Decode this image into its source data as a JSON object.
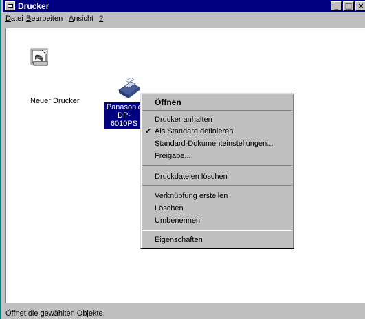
{
  "window": {
    "title": "Drucker",
    "buttons": {
      "minimize": "_",
      "maximize": "□",
      "close": "×"
    }
  },
  "menubar": {
    "items": [
      {
        "label": "Datei",
        "accel": "D"
      },
      {
        "label": "Bearbeiten",
        "accel": "B"
      },
      {
        "label": "Ansicht",
        "accel": "A"
      },
      {
        "label": "?",
        "accel": "?"
      }
    ]
  },
  "icons": [
    {
      "name": "new-printer",
      "label": "Neuer Drucker",
      "icon": "add-printer-icon"
    },
    {
      "name": "panasonic",
      "label_line1": "Panasonic",
      "label_line2": "DP-6010PS",
      "icon": "printer-icon",
      "selected": true
    }
  ],
  "context_menu": {
    "items": [
      {
        "label": "Öffnen",
        "default": true
      },
      {
        "label": "Drucker anhalten"
      },
      {
        "label": "Als Standard definieren",
        "checked": true
      },
      {
        "label": "Standard-Dokumenteinstellungen..."
      },
      {
        "label": "Freigabe..."
      },
      {
        "label": "Druckdateien löschen"
      },
      {
        "label": "Verknüpfung erstellen"
      },
      {
        "label": "Löschen"
      },
      {
        "label": "Umbenennen"
      },
      {
        "label": "Eigenschaften"
      }
    ],
    "check_mark": "✔"
  },
  "status": {
    "text": "Öffnet die gewählten Objekte."
  },
  "colors": {
    "titlebar": "#000080",
    "face": "#c0c0c0",
    "selection": "#000080",
    "desktop_edge": "#008080"
  }
}
